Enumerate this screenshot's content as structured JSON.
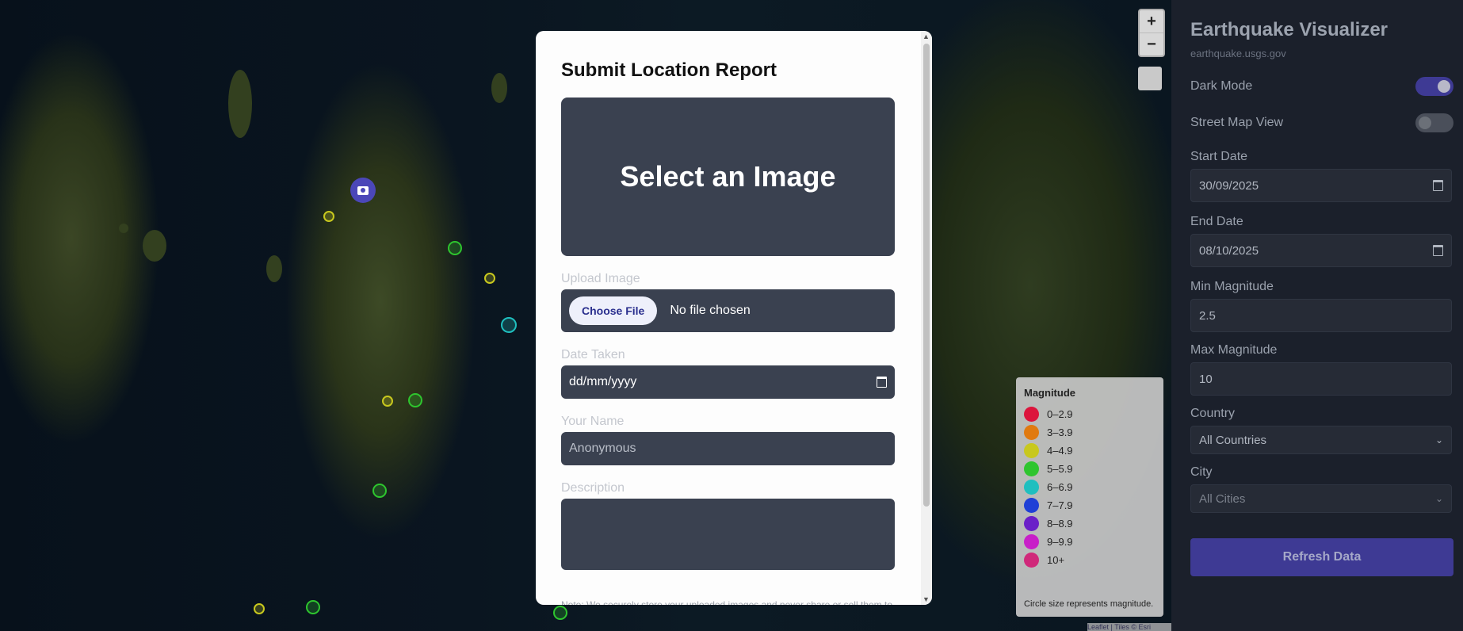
{
  "map": {
    "zoom_in": "+",
    "zoom_out": "−",
    "attribution": "Leaflet | Tiles © Esri"
  },
  "legend": {
    "title": "Magnitude",
    "items": [
      {
        "label": "0–2.9",
        "color": "#dc143c"
      },
      {
        "label": "3–3.9",
        "color": "#e07a10"
      },
      {
        "label": "4–4.9",
        "color": "#c8c81e"
      },
      {
        "label": "5–5.9",
        "color": "#2ec52e"
      },
      {
        "label": "6–6.9",
        "color": "#1fbfbf"
      },
      {
        "label": "7–7.9",
        "color": "#1f3fd6"
      },
      {
        "label": "8–8.9",
        "color": "#6a1fc8"
      },
      {
        "label": "9–9.9",
        "color": "#c81fc8"
      },
      {
        "label": "10+",
        "color": "#d0287a"
      }
    ],
    "footer": "Circle size represents magnitude."
  },
  "sidebar": {
    "title": "Earthquake Visualizer",
    "subtitle": "earthquake.usgs.gov",
    "dark_mode_label": "Dark Mode",
    "dark_mode_on": true,
    "street_map_label": "Street Map View",
    "street_map_on": false,
    "start_date_label": "Start Date",
    "start_date": "30/09/2025",
    "end_date_label": "End Date",
    "end_date": "08/10/2025",
    "min_mag_label": "Min Magnitude",
    "min_mag": "2.5",
    "max_mag_label": "Max Magnitude",
    "max_mag": "10",
    "country_label": "Country",
    "country": "All Countries",
    "city_label": "City",
    "city": "All Cities",
    "refresh_label": "Refresh Data",
    "accent": "#3e3a94"
  },
  "modal": {
    "title": "Submit Location Report",
    "image_placeholder": "Select an Image",
    "upload_label": "Upload Image",
    "choose_file": "Choose File",
    "no_file": "No file chosen",
    "date_label": "Date Taken",
    "date_placeholder": "dd/mm/yyyy",
    "name_label": "Your Name",
    "name_placeholder": "Anonymous",
    "description_label": "Description",
    "note": "Note: We securely store your uploaded images and never share or sell them to"
  }
}
